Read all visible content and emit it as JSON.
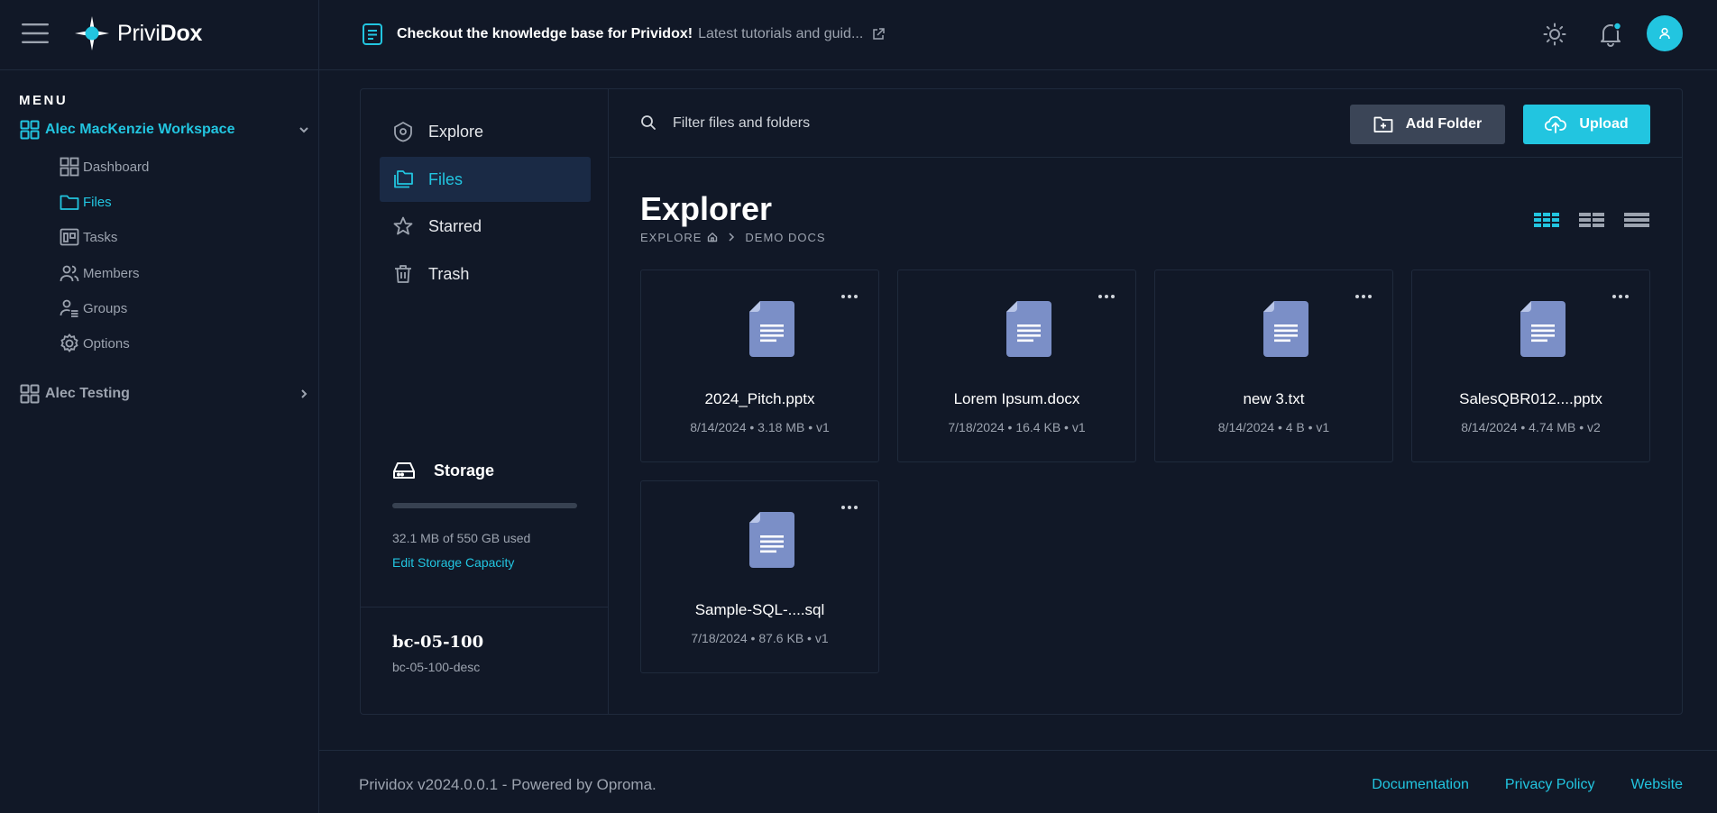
{
  "header": {
    "brand_light": "Privi",
    "brand_bold": "Dox",
    "announcement_bold": "Checkout the knowledge base for Prividox!",
    "announcement_link": "Latest tutorials and guid...",
    "accent": "#22c5e0"
  },
  "sidebar": {
    "menu_label": "MENU",
    "workspaces": [
      {
        "label": "Alec MacKenzie Workspace",
        "expanded": true
      },
      {
        "label": "Alec Testing",
        "expanded": false
      }
    ],
    "items": [
      {
        "label": "Dashboard",
        "icon": "dashboard-icon"
      },
      {
        "label": "Files",
        "icon": "folder-icon",
        "active": true
      },
      {
        "label": "Tasks",
        "icon": "tasks-icon"
      },
      {
        "label": "Members",
        "icon": "members-icon"
      },
      {
        "label": "Groups",
        "icon": "groups-icon"
      },
      {
        "label": "Options",
        "icon": "gear-icon"
      }
    ]
  },
  "inner_nav": {
    "items": [
      {
        "label": "Explore",
        "icon": "explore-icon"
      },
      {
        "label": "Files",
        "icon": "files-icon",
        "active": true
      },
      {
        "label": "Starred",
        "icon": "star-icon"
      },
      {
        "label": "Trash",
        "icon": "trash-icon"
      }
    ],
    "storage": {
      "title": "Storage",
      "used_text": "32.1 MB of 550 GB used",
      "used_fraction": 0.0001,
      "edit_label": "Edit Storage Capacity"
    },
    "project": {
      "name": "bc-05-100",
      "desc": "bc-05-100-desc"
    }
  },
  "toolbar": {
    "search_placeholder": "Filter files and folders",
    "add_folder_label": "Add Folder",
    "upload_label": "Upload"
  },
  "explorer": {
    "title": "Explorer",
    "breadcrumb_root": "EXPLORE",
    "breadcrumb_current": "DEMO DOCS",
    "files": [
      {
        "name": "2024_Pitch.pptx",
        "meta": "8/14/2024 • 3.18 MB • v1"
      },
      {
        "name": "Lorem Ipsum.docx",
        "meta": "7/18/2024 • 16.4 KB • v1"
      },
      {
        "name": "new 3.txt",
        "meta": "8/14/2024 • 4 B • v1"
      },
      {
        "name": "SalesQBR012....pptx",
        "meta": "8/14/2024 • 4.74 MB • v2"
      },
      {
        "name": "Sample-SQL-....sql",
        "meta": "7/18/2024 • 87.6 KB • v1"
      }
    ]
  },
  "footer": {
    "copyright": "Prividox v2024.0.0.1 - Powered by Oproma.",
    "links": [
      "Documentation",
      "Privacy Policy",
      "Website"
    ]
  }
}
